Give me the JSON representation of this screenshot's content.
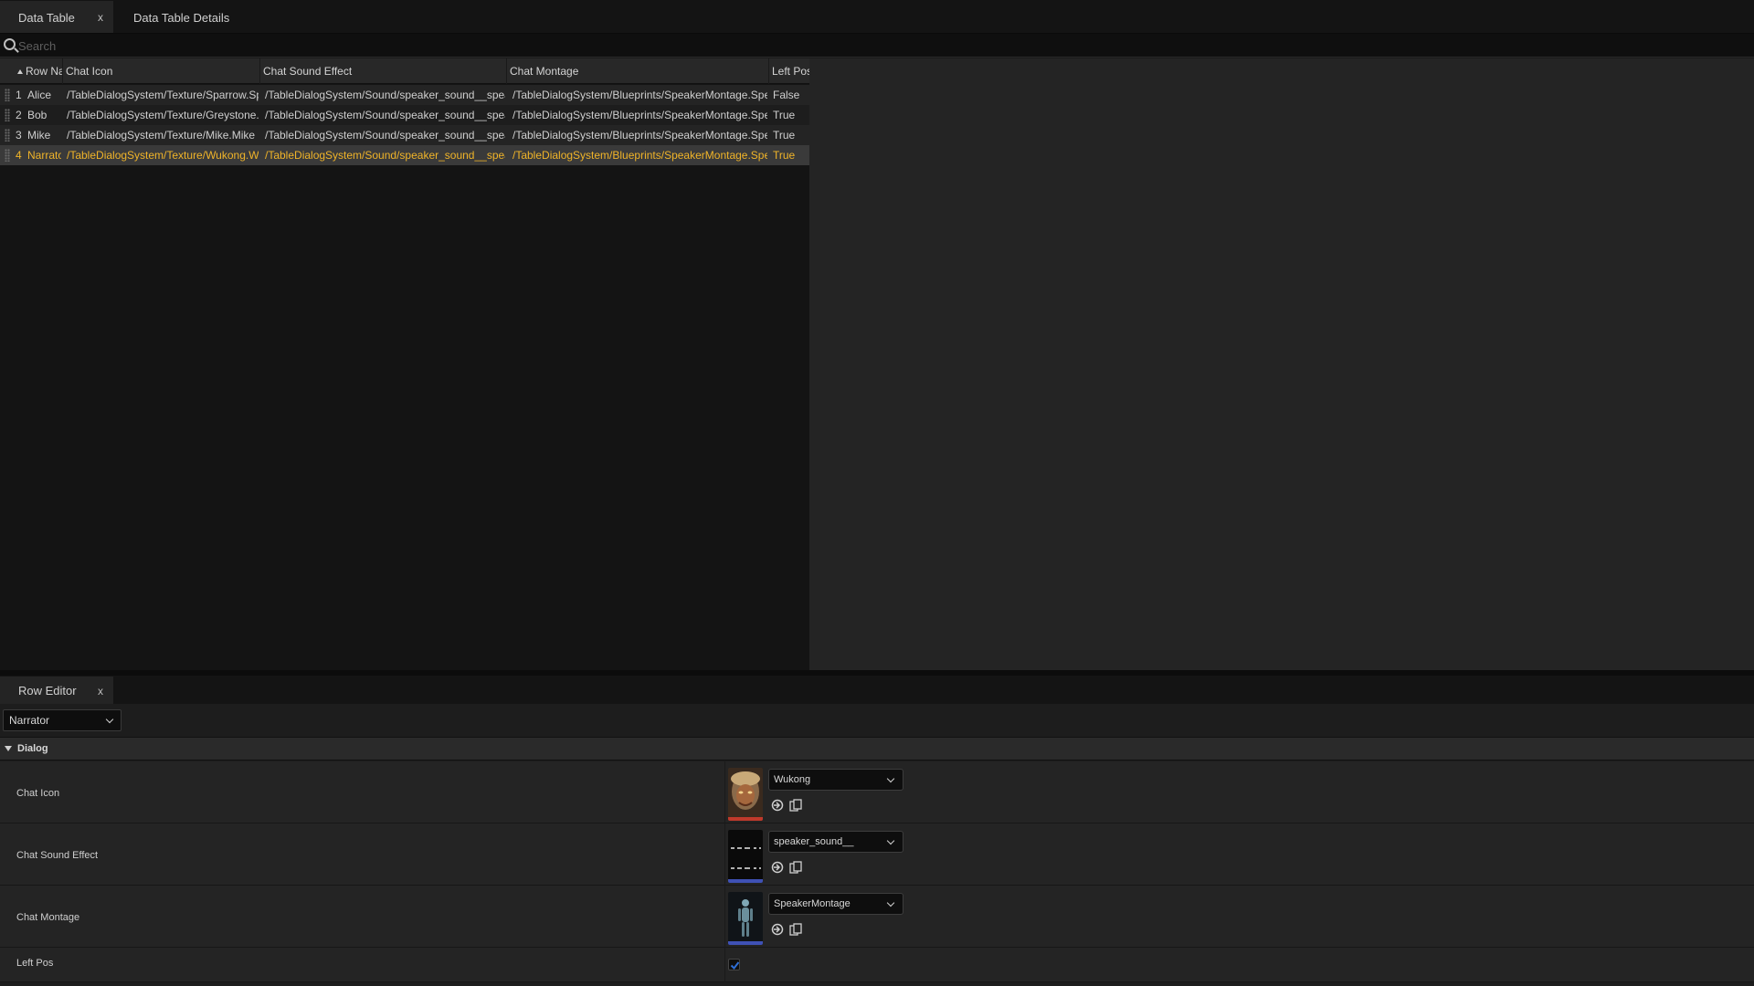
{
  "tabs": {
    "data_table": "Data Table",
    "data_table_details": "Data Table Details",
    "close_glyph": "x"
  },
  "search": {
    "placeholder": "Search"
  },
  "table": {
    "headers": {
      "row_name": "Row Nan",
      "chat_icon": "Chat Icon",
      "chat_sound_effect": "Chat Sound Effect",
      "chat_montage": "Chat Montage",
      "left_pos": "Left Pos"
    },
    "rows": [
      {
        "index": "1",
        "name": "Alice",
        "chat_icon": "/TableDialogSystem/Texture/Sparrow.Sparrow",
        "chat_sound_effect": "/TableDialogSystem/Sound/speaker_sound__speaker_sound__",
        "chat_montage": "/TableDialogSystem/Blueprints/SpeakerMontage.SpeakerMontage",
        "left_pos": "False"
      },
      {
        "index": "2",
        "name": "Bob",
        "chat_icon": "/TableDialogSystem/Texture/Greystone.Greystone",
        "chat_sound_effect": "/TableDialogSystem/Sound/speaker_sound__speaker_sound__",
        "chat_montage": "/TableDialogSystem/Blueprints/SpeakerMontage.SpeakerMontage",
        "left_pos": "True"
      },
      {
        "index": "3",
        "name": "Mike",
        "chat_icon": "/TableDialogSystem/Texture/Mike.Mike",
        "chat_sound_effect": "/TableDialogSystem/Sound/speaker_sound__speaker_sound__",
        "chat_montage": "/TableDialogSystem/Blueprints/SpeakerMontage.SpeakerMontage",
        "left_pos": "True"
      },
      {
        "index": "4",
        "name": "Narrator",
        "chat_icon": "/TableDialogSystem/Texture/Wukong.Wukong",
        "chat_sound_effect": "/TableDialogSystem/Sound/speaker_sound__speaker_sound__",
        "chat_montage": "/TableDialogSystem/Blueprints/SpeakerMontage.SpeakerMontage",
        "left_pos": "True",
        "selected": true
      }
    ]
  },
  "row_editor": {
    "tab_label": "Row Editor",
    "close_glyph": "x",
    "selected_row": "Narrator",
    "section_title": "Dialog",
    "properties": {
      "chat_icon": {
        "label": "Chat Icon",
        "value": "Wukong"
      },
      "chat_sound_effect": {
        "label": "Chat Sound Effect",
        "value": "speaker_sound__"
      },
      "chat_montage": {
        "label": "Chat Montage",
        "value": "SpeakerMontage"
      },
      "left_pos": {
        "label": "Left Pos",
        "checked": true
      }
    }
  },
  "colors": {
    "selected_text": "#f0b429",
    "accent_blue": "#2f6fd6"
  }
}
